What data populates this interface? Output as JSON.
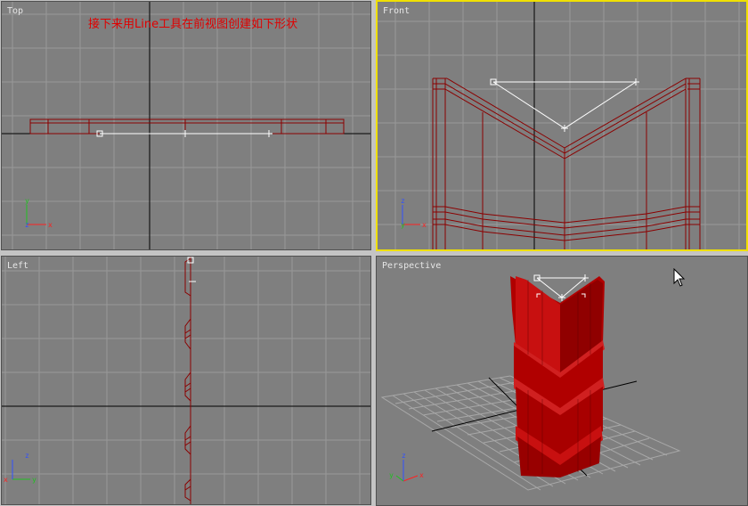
{
  "viewports": {
    "top": {
      "label": "Top"
    },
    "front": {
      "label": "Front",
      "active": true
    },
    "left": {
      "label": "Left"
    },
    "perspective": {
      "label": "Perspective"
    }
  },
  "instruction_text": "接下来用Line工具在前视图创建如下形状",
  "axis_labels": {
    "x": "x",
    "y": "y",
    "z": "z"
  },
  "colors": {
    "viewport_bg": "#7f7f7f",
    "grid": "#999999",
    "world_axis": "#000000",
    "wire": "#8b0000",
    "spline": "#ffffff",
    "active_border": "#f0e000",
    "instruction": "#e00000",
    "axis_x": "#ff2020",
    "axis_y": "#20c020",
    "axis_z": "#3050ff"
  },
  "icons": {
    "cursor": "arrow-cursor-icon"
  }
}
